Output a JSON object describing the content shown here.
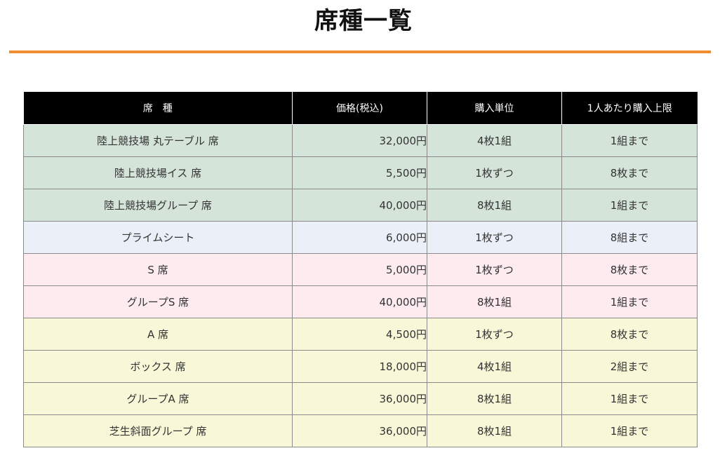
{
  "page": {
    "title": "席種一覧",
    "accent_color": "#f08c32"
  },
  "table": {
    "headers": [
      "席　種",
      "価格(税込)",
      "購入単位",
      "1人あたり購入上限"
    ],
    "rows": [
      {
        "name": "陸上競技場 丸テーブル 席",
        "price": "32,000円",
        "unit": "4枚1組",
        "limit": "1組まで",
        "color": "#d5e4d9"
      },
      {
        "name": "陸上競技場イス 席",
        "price": "5,500円",
        "unit": "1枚ずつ",
        "limit": "8枚まで",
        "color": "#d5e4d9"
      },
      {
        "name": "陸上競技場グループ 席",
        "price": "40,000円",
        "unit": "8枚1組",
        "limit": "1組まで",
        "color": "#d5e4d9"
      },
      {
        "name": "プライムシート",
        "price": "6,000円",
        "unit": "1枚ずつ",
        "limit": "8組まで",
        "color": "#ebf0f8"
      },
      {
        "name": "S 席",
        "price": "5,000円",
        "unit": "1枚ずつ",
        "limit": "8枚まで",
        "color": "#fdebf0"
      },
      {
        "name": "グループS 席",
        "price": "40,000円",
        "unit": "8枚1組",
        "limit": "1組まで",
        "color": "#fdebf0"
      },
      {
        "name": "A 席",
        "price": "4,500円",
        "unit": "1枚ずつ",
        "limit": "8枚まで",
        "color": "#f8f7d8"
      },
      {
        "name": "ボックス 席",
        "price": "18,000円",
        "unit": "4枚1組",
        "limit": "2組まで",
        "color": "#f8f7d8"
      },
      {
        "name": "グループA 席",
        "price": "36,000円",
        "unit": "8枚1組",
        "limit": "1組まで",
        "color": "#f8f7d8"
      },
      {
        "name": "芝生斜面グループ 席",
        "price": "36,000円",
        "unit": "8枚1組",
        "limit": "1組まで",
        "color": "#f8f7d8"
      }
    ]
  }
}
